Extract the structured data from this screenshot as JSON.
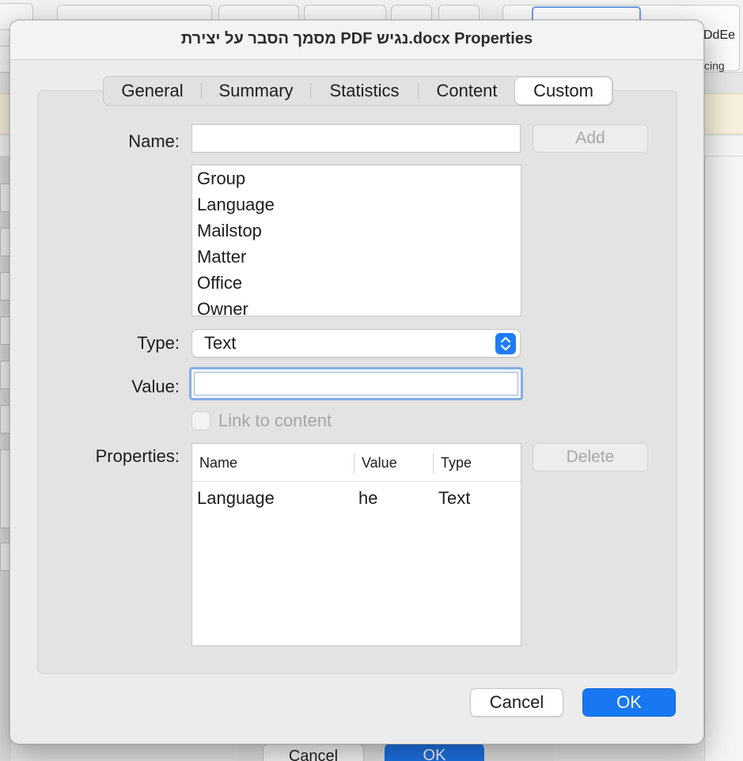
{
  "background": {
    "style_preview_text": "DdEe",
    "spacing_text": "cing",
    "cancel_label": "Cancel",
    "ok_label": "OK"
  },
  "dialog": {
    "title": "מסמך הסבר על יצירת PDF נגיש.docx Properties",
    "tabs": [
      "General",
      "Summary",
      "Statistics",
      "Content",
      "Custom"
    ],
    "selected_tab": "Custom",
    "name_label": "Name:",
    "name_value": "",
    "add_label": "Add",
    "property_names": [
      "Group",
      "Language",
      "Mailstop",
      "Matter",
      "Office",
      "Owner"
    ],
    "type_label": "Type:",
    "type_value": "Text",
    "value_label": "Value:",
    "value_value": "",
    "link_label": "Link to content",
    "link_checked": false,
    "properties_label": "Properties:",
    "delete_label": "Delete",
    "table": {
      "columns": [
        "Name",
        "Value",
        "Type"
      ],
      "rows": [
        {
          "name": "Language",
          "value": "he",
          "type": "Text"
        }
      ]
    },
    "cancel_label": "Cancel",
    "ok_label": "OK"
  },
  "colors": {
    "accent": "#1778f2",
    "focus_ring": "#84aee6"
  }
}
